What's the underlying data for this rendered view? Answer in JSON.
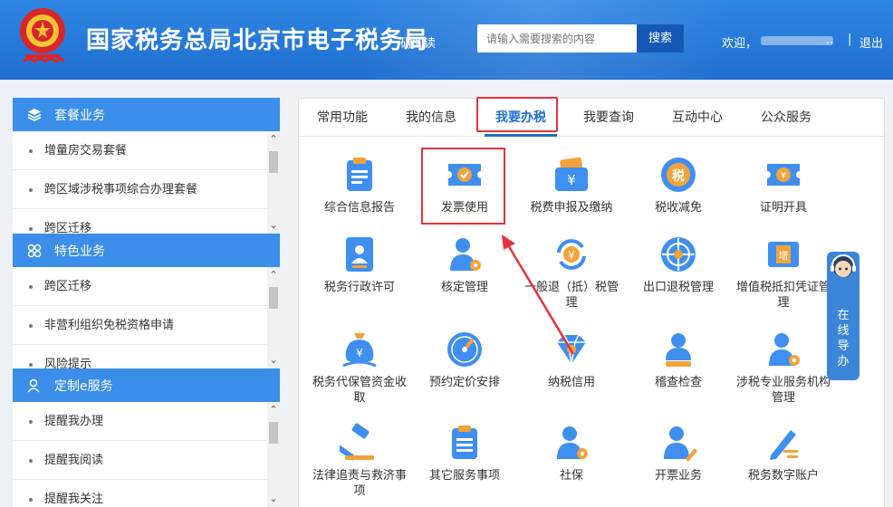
{
  "header": {
    "title": "国家税务总局北京市电子税务局",
    "accessible": "碍阅读",
    "search_placeholder": "请输入需要搜索的内容",
    "search_button": "搜索",
    "welcome": "欢迎，",
    "user_suffix": "..",
    "separator": "|",
    "logout": "退出"
  },
  "sidebar": [
    {
      "title": "套餐业务",
      "icon": "cube-stack-icon",
      "items": [
        "增量房交易套餐",
        "跨区域涉税事项综合办理套餐",
        "跨区迁移"
      ]
    },
    {
      "title": "特色业务",
      "icon": "grid-flower-icon",
      "items": [
        "跨区迁移",
        "非营利组织免税资格申请",
        "风险提示"
      ]
    },
    {
      "title": "定制e服务",
      "icon": "user-icon",
      "items": [
        "提醒我办理",
        "提醒我阅读",
        "提醒我关注"
      ]
    }
  ],
  "tabs": [
    "常用功能",
    "我的信息",
    "我要办税",
    "我要查询",
    "互动中心",
    "公众服务"
  ],
  "active_tab": "我要办税",
  "grid": [
    {
      "label": "综合信息报告",
      "icon": "clipboard-icon"
    },
    {
      "label": "发票使用",
      "icon": "invoice-ticket-icon"
    },
    {
      "label": "税费申报及缴纳",
      "icon": "yuan-wallet-icon"
    },
    {
      "label": "税收减免",
      "icon": "tax-coin-icon"
    },
    {
      "label": "证明开具",
      "icon": "certificate-ticket-icon"
    },
    {
      "label": "税务行政许可",
      "icon": "id-card-icon"
    },
    {
      "label": "核定管理",
      "icon": "person-gear-icon"
    },
    {
      "label": "一般退（抵）税管理",
      "icon": "yuan-refund-icon"
    },
    {
      "label": "出口退税管理",
      "icon": "globe-icon"
    },
    {
      "label": "增值税抵扣凭证管理",
      "icon": "vat-receipt-icon"
    },
    {
      "label": "税务代保管资金收取",
      "icon": "money-bag-icon"
    },
    {
      "label": "预约定价安排",
      "icon": "compass-icon"
    },
    {
      "label": "纳税信用",
      "icon": "diamond-icon"
    },
    {
      "label": "稽查检查",
      "icon": "person-stamp-icon"
    },
    {
      "label": "涉税专业服务机构管理",
      "icon": "person-gear-icon"
    },
    {
      "label": "法律追责与救济事项",
      "icon": "gavel-icon"
    },
    {
      "label": "其它服务事项",
      "icon": "document-list-icon"
    },
    {
      "label": "社保",
      "icon": "person-gear-icon"
    },
    {
      "label": "开票业务",
      "icon": "person-pen-icon"
    },
    {
      "label": "税务数字账户",
      "icon": "pen-lines-icon"
    }
  ],
  "guide": {
    "label": "在线导办"
  },
  "colors": {
    "header_blue": "#1f6fd0",
    "sidebar_head": "#3b8ee9",
    "highlight_red": "#e8313a",
    "icon_blue": "#3e8ff0",
    "icon_orange": "#f3a23b"
  }
}
